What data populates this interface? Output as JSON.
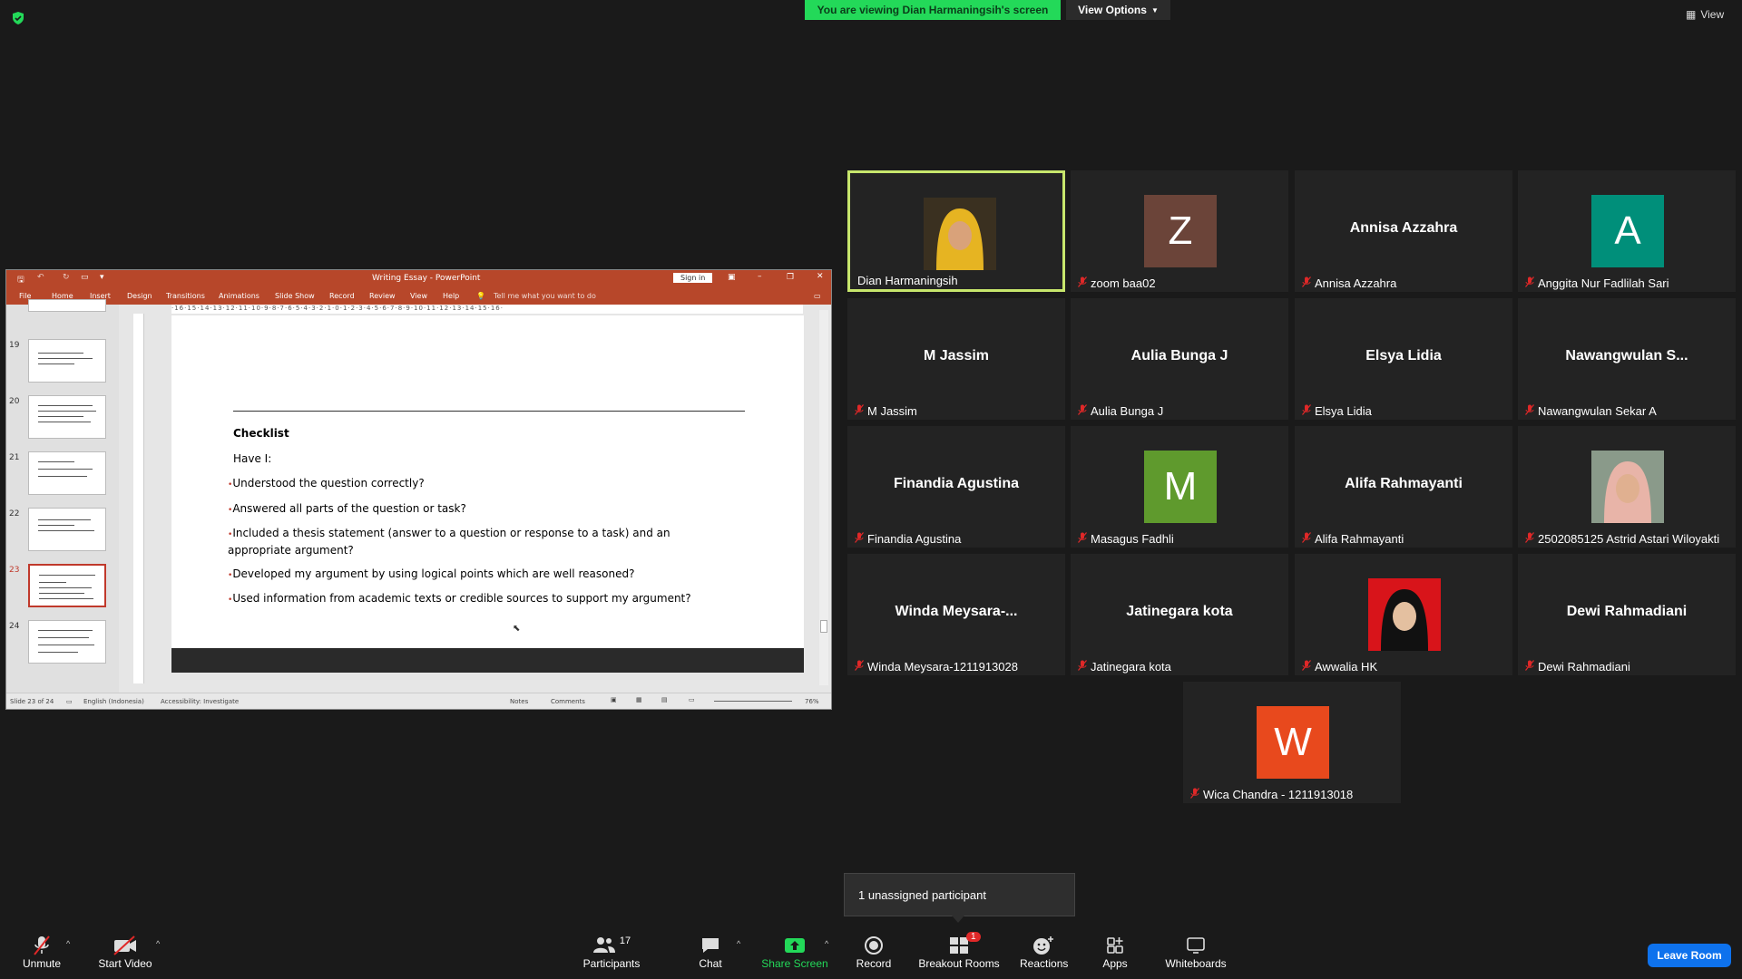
{
  "top": {
    "banner": "You are viewing Dian Harmaningsih's screen",
    "view_options": "View Options",
    "view": "View"
  },
  "ppt": {
    "title": "Writing Essay  -  PowerPoint",
    "sign_in": "Sign in",
    "tabs": [
      "File",
      "Home",
      "Insert",
      "Design",
      "Transitions",
      "Animations",
      "Slide Show",
      "Record",
      "Review",
      "View",
      "Help"
    ],
    "tell_me": "Tell me what you want to do",
    "ruler": "·16·15·14·13·12·11·10·9·8·7·6·5·4·3·2·1·0·1·2·3·4·5·6·7·8·9·10·11·12·13·14·15·16·",
    "thumb_numbers": [
      "19",
      "20",
      "21",
      "22",
      "23",
      "24"
    ],
    "slide": {
      "heading": "Checklist",
      "intro": "Have I:",
      "bullets": [
        "Understood the question correctly?",
        "Answered all parts of the question or task?",
        "Included a thesis statement (answer to a question or response to a task) and an appropriate argument?",
        "Developed my argument by using logical points which are well reasoned?",
        "Used information from academic texts or credible sources to support my argument?"
      ]
    },
    "status": {
      "slide": "Slide 23 of 24",
      "language": "English (Indonesia)",
      "accessibility": "Accessibility: Investigate",
      "notes": "Notes",
      "comments": "Comments",
      "zoom": "76%"
    }
  },
  "participants": [
    {
      "big": "",
      "name": "Dian Harmaningsih",
      "avatar": "photo-hijab-yellow",
      "muted": false
    },
    {
      "big": "",
      "name": "zoom baa02",
      "letter": "Z",
      "color": "#6b4439",
      "muted": true
    },
    {
      "big": "Annisa Azzahra",
      "name": "Annisa Azzahra",
      "muted": true
    },
    {
      "big": "",
      "name": "Anggita Nur Fadlilah Sari",
      "letter": "A",
      "color": "#008f7a",
      "muted": true
    },
    {
      "big": "M Jassim",
      "name": "M Jassim",
      "muted": true
    },
    {
      "big": "Aulia Bunga J",
      "name": "Aulia Bunga J",
      "muted": true
    },
    {
      "big": "Elsya Lidia",
      "name": "Elsya Lidia",
      "muted": true
    },
    {
      "big": "Nawangwulan  S...",
      "name": "Nawangwulan Sekar A",
      "muted": true
    },
    {
      "big": "Finandia Agustina",
      "name": "Finandia Agustina",
      "muted": true
    },
    {
      "big": "",
      "name": "Masagus Fadhli",
      "letter": "M",
      "color": "#5f9a2d",
      "muted": true
    },
    {
      "big": "Alifa Rahmayanti",
      "name": "Alifa Rahmayanti",
      "muted": true
    },
    {
      "big": "",
      "name": "2502085125 Astrid Astari Wiloyakti",
      "avatar": "photo-hijab-pink",
      "muted": true
    },
    {
      "big": "Winda  Meysara-...",
      "name": "Winda Meysara-1211913028",
      "muted": true
    },
    {
      "big": "Jatinegara kota",
      "name": "Jatinegara kota",
      "muted": true
    },
    {
      "big": "",
      "name": "Awwalia HK",
      "avatar": "photo-hijab-red",
      "muted": true
    },
    {
      "big": "Dewi Rahmadiani",
      "name": "Dewi Rahmadiani",
      "muted": true
    },
    {
      "big": "",
      "name": "Wica Chandra - 1211913018",
      "letter": "W",
      "color": "#e8491d",
      "muted": true
    }
  ],
  "toolbar": {
    "unmute": "Unmute",
    "start_video": "Start Video",
    "participants": "Participants",
    "participants_count": "17",
    "chat": "Chat",
    "share_screen": "Share Screen",
    "record": "Record",
    "breakout_rooms": "Breakout Rooms",
    "breakout_badge": "1",
    "reactions": "Reactions",
    "apps": "Apps",
    "whiteboards": "Whiteboards",
    "leave": "Leave Room"
  },
  "popover": "1 unassigned participant",
  "colors": {
    "banner": "#23d959",
    "active_border": "#c7e66c",
    "leave": "#0e72ed",
    "ppt_red": "#b7472a"
  }
}
